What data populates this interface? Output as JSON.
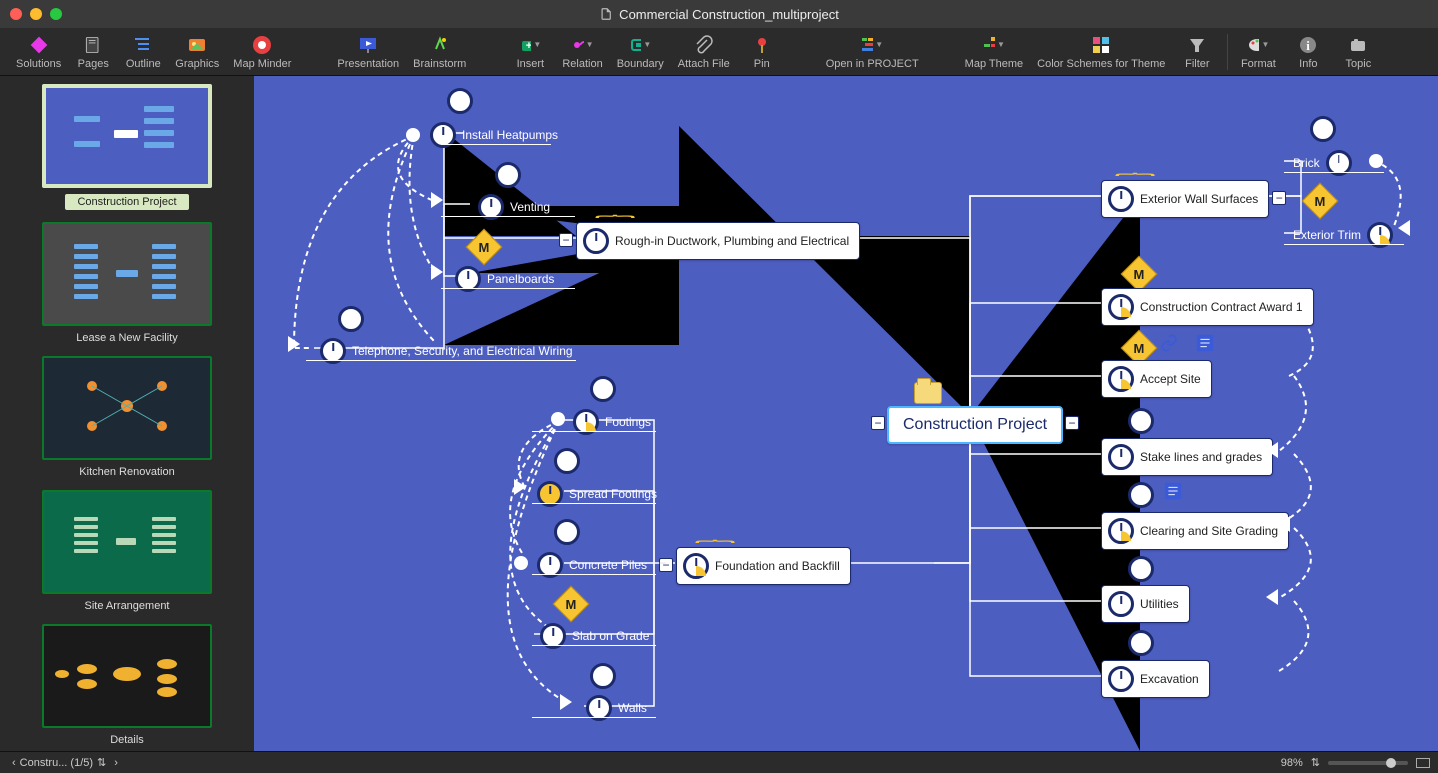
{
  "window": {
    "title": "Commercial Construction_multiproject"
  },
  "toolbar": {
    "solutions": "Solutions",
    "pages": "Pages",
    "outline": "Outline",
    "graphics": "Graphics",
    "mapminder": "Map Minder",
    "presentation": "Presentation",
    "brainstorm": "Brainstorm",
    "insert": "Insert",
    "relation": "Relation",
    "boundary": "Boundary",
    "attachfile": "Attach File",
    "pin": "Pin",
    "openproject": "Open in PROJECT",
    "maptheme": "Map Theme",
    "colorschemes": "Color Schemes for Theme",
    "filter": "Filter",
    "format": "Format",
    "info": "Info",
    "topic": "Topic"
  },
  "sidebar": {
    "pages": [
      {
        "label": "Construction Project",
        "bg": "#4d5ec1"
      },
      {
        "label": "Lease a New Facility",
        "bg": "#4a4a4a"
      },
      {
        "label": "Kitchen Renovation",
        "bg": "#1e2936"
      },
      {
        "label": "Site Arrangement",
        "bg": "#0a6a4a"
      },
      {
        "label": "Details",
        "bg": "#1a1a1a"
      }
    ]
  },
  "canvas": {
    "root": "Construction Project",
    "nodes": {
      "heatpumps": "Install Heatpumps",
      "venting": "Venting",
      "panelboards": "Panelboards",
      "telephone": "Telephone, Security, and Electrical Wiring",
      "roughin": "Rough-in Ductwork, Plumbing and Electrical",
      "footings": "Footings",
      "spreadfootings": "Spread Footings",
      "concretepiles": "Concrete Piles",
      "slabongrade": "Slab on Grade",
      "walls": "Walls",
      "foundation": "Foundation and Backfill",
      "exteriorwall": "Exterior Wall Surfaces",
      "brick": "Brick",
      "exteriortrim": "Exterior Trim",
      "contractaward": "Construction Contract Award 1",
      "acceptsite": "Accept Site",
      "stakelines": "Stake lines and grades",
      "clearing": "Clearing and Site Grading",
      "utilities": "Utilities",
      "excavation": "Excavation"
    }
  },
  "statusbar": {
    "tab": "Constru...  (1/5)",
    "zoom": "98%"
  }
}
